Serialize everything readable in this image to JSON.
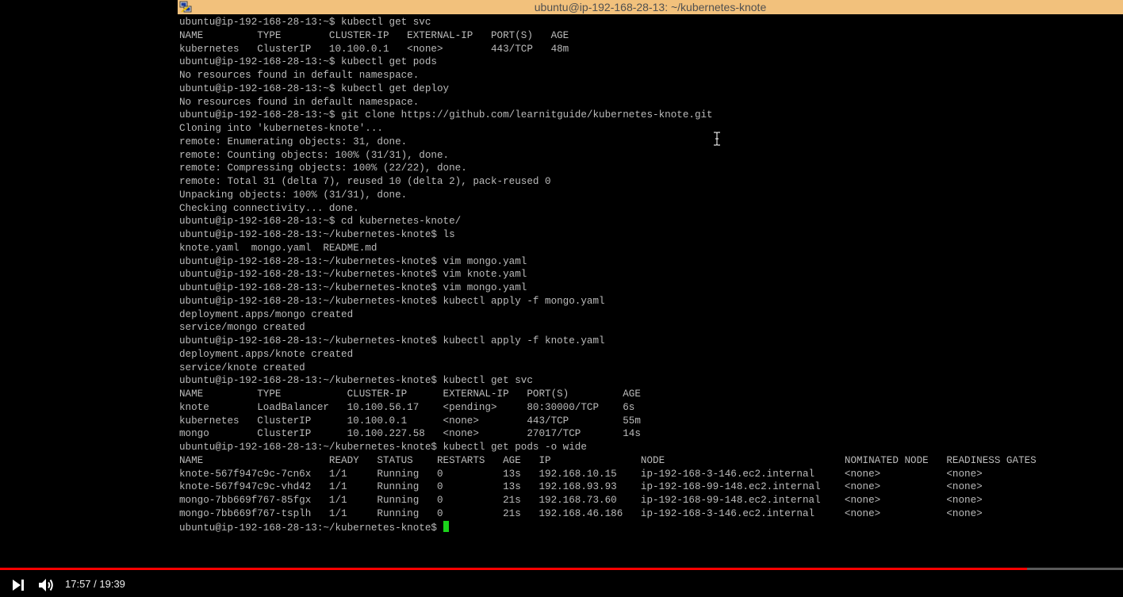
{
  "window": {
    "title": "ubuntu@ip-192-168-28-13: ~/kubernetes-knote",
    "icon": "putty-icon",
    "titlebar_color": "#f2c17c"
  },
  "terminal": {
    "text_color": "#bbbbbb",
    "cursor_color": "#1bd31b",
    "lines": [
      "ubuntu@ip-192-168-28-13:~$ kubectl get svc",
      "NAME         TYPE        CLUSTER-IP   EXTERNAL-IP   PORT(S)   AGE",
      "kubernetes   ClusterIP   10.100.0.1   <none>        443/TCP   48m",
      "ubuntu@ip-192-168-28-13:~$ kubectl get pods",
      "No resources found in default namespace.",
      "ubuntu@ip-192-168-28-13:~$ kubectl get deploy",
      "No resources found in default namespace.",
      "ubuntu@ip-192-168-28-13:~$ git clone https://github.com/learnitguide/kubernetes-knote.git",
      "Cloning into 'kubernetes-knote'...",
      "remote: Enumerating objects: 31, done.",
      "remote: Counting objects: 100% (31/31), done.",
      "remote: Compressing objects: 100% (22/22), done.",
      "remote: Total 31 (delta 7), reused 10 (delta 2), pack-reused 0",
      "Unpacking objects: 100% (31/31), done.",
      "Checking connectivity... done.",
      "ubuntu@ip-192-168-28-13:~$ cd kubernetes-knote/",
      "ubuntu@ip-192-168-28-13:~/kubernetes-knote$ ls",
      "knote.yaml  mongo.yaml  README.md",
      "ubuntu@ip-192-168-28-13:~/kubernetes-knote$ vim mongo.yaml",
      "ubuntu@ip-192-168-28-13:~/kubernetes-knote$ vim knote.yaml",
      "ubuntu@ip-192-168-28-13:~/kubernetes-knote$ vim mongo.yaml",
      "ubuntu@ip-192-168-28-13:~/kubernetes-knote$ kubectl apply -f mongo.yaml",
      "deployment.apps/mongo created",
      "service/mongo created",
      "ubuntu@ip-192-168-28-13:~/kubernetes-knote$ kubectl apply -f knote.yaml",
      "deployment.apps/knote created",
      "service/knote created",
      "ubuntu@ip-192-168-28-13:~/kubernetes-knote$ kubectl get svc",
      "NAME         TYPE           CLUSTER-IP      EXTERNAL-IP   PORT(S)         AGE",
      "knote        LoadBalancer   10.100.56.17    <pending>     80:30000/TCP    6s",
      "kubernetes   ClusterIP      10.100.0.1      <none>        443/TCP         55m",
      "mongo        ClusterIP      10.100.227.58   <none>        27017/TCP       14s",
      "ubuntu@ip-192-168-28-13:~/kubernetes-knote$ kubectl get pods -o wide",
      "NAME                     READY   STATUS    RESTARTS   AGE   IP               NODE                              NOMINATED NODE   READINESS GATES",
      "knote-567f947c9c-7cn6x   1/1     Running   0          13s   192.168.10.15    ip-192-168-3-146.ec2.internal     <none>           <none>",
      "knote-567f947c9c-vhd42   1/1     Running   0          13s   192.168.93.93    ip-192-168-99-148.ec2.internal    <none>           <none>",
      "mongo-7bb669f767-85fgx   1/1     Running   0          21s   192.168.73.60    ip-192-168-99-148.ec2.internal    <none>           <none>",
      "mongo-7bb669f767-tsplh   1/1     Running   0          21s   192.168.46.186   ip-192-168-3-146.ec2.internal     <none>           <none>"
    ],
    "prompt": "ubuntu@ip-192-168-28-13:~/kubernetes-knote$ "
  },
  "player": {
    "time_display": "17:57 / 19:39",
    "progress_fraction": 0.9143,
    "progress_color": "#ff0000",
    "next_icon": "next-icon",
    "volume_icon": "volume-icon"
  }
}
